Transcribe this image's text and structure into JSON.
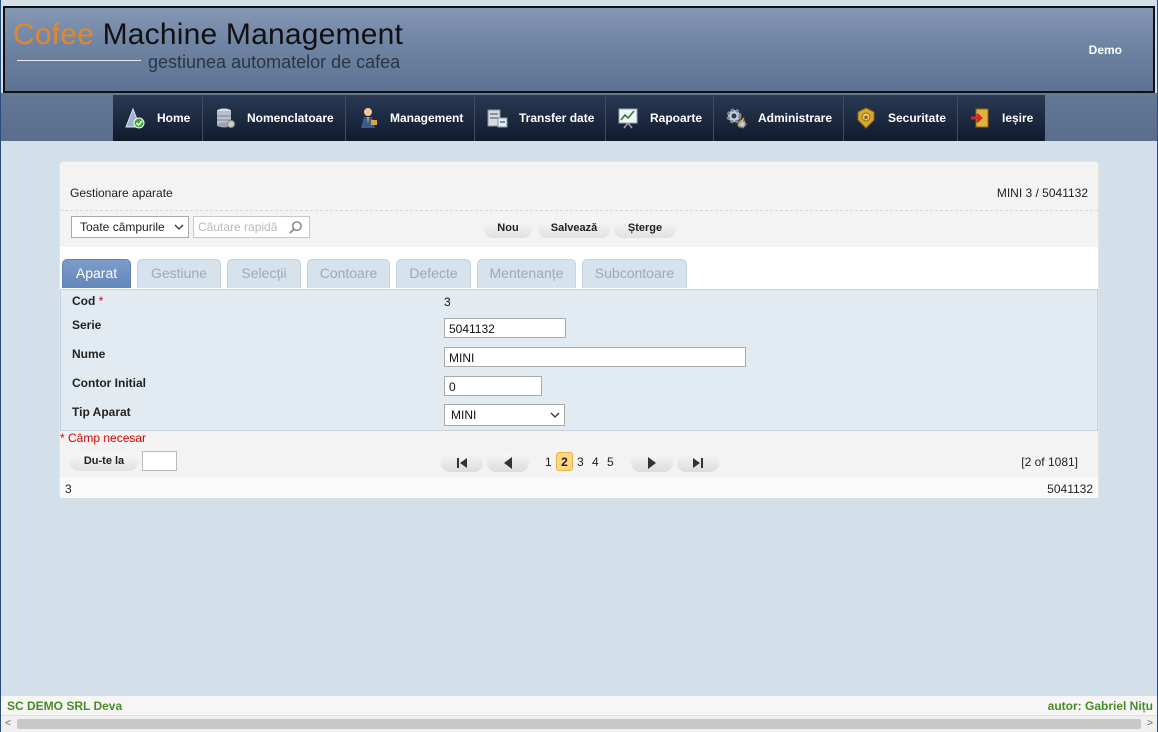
{
  "header": {
    "title_accent": "Cofee",
    "title_rest": " Machine Management",
    "subtitle": "gestiunea automatelor de cafea",
    "user": "Demo"
  },
  "menu": [
    {
      "label": "Home",
      "icon": "home-icon"
    },
    {
      "label": "Nomenclatoare",
      "icon": "database-icon"
    },
    {
      "label": "Management",
      "icon": "manager-icon"
    },
    {
      "label": "Transfer date",
      "icon": "transfer-icon"
    },
    {
      "label": "Rapoarte",
      "icon": "chart-icon"
    },
    {
      "label": "Administrare",
      "icon": "gear-icon"
    },
    {
      "label": "Securitate",
      "icon": "badge-icon"
    },
    {
      "label": "Ieșire",
      "icon": "exit-icon"
    }
  ],
  "panel": {
    "title": "Gestionare aparate",
    "record": "MINI 3 / 5041132"
  },
  "toolbar": {
    "filter_value": "Toate câmpurile",
    "search_placeholder": "Căutare rapidă",
    "new_label": "Nou",
    "save_label": "Salvează",
    "delete_label": "Șterge"
  },
  "tabs": [
    "Aparat",
    "Gestiune",
    "Selecții",
    "Contoare",
    "Defecte",
    "Mentenanțe",
    "Subcontoare"
  ],
  "form": {
    "cod_label": "Cod",
    "cod_required": "*",
    "cod_value": "3",
    "serie_label": "Serie",
    "serie_value": "5041132",
    "nume_label": "Nume",
    "nume_value": "MINI",
    "contor_label": "Contor Initial",
    "contor_value": "0",
    "tip_label": "Tip Aparat",
    "tip_value": "MINI"
  },
  "required_note": "* Câmp necesar",
  "pager": {
    "goto_label": "Du-te la",
    "pages": [
      "1",
      "2",
      "3",
      "4",
      "5"
    ],
    "count": "[2 of 1081]"
  },
  "status": {
    "left": "3",
    "right": "5041132"
  },
  "footer": {
    "left": "SC DEMO SRL Deva",
    "right": "autor: Gabriel Nițu"
  },
  "colors": {
    "accent": "#e1882a",
    "required": "#d40000",
    "footer_text": "#4b8b26",
    "active_tab": "#6486b9",
    "active_page": "#fcd680"
  }
}
